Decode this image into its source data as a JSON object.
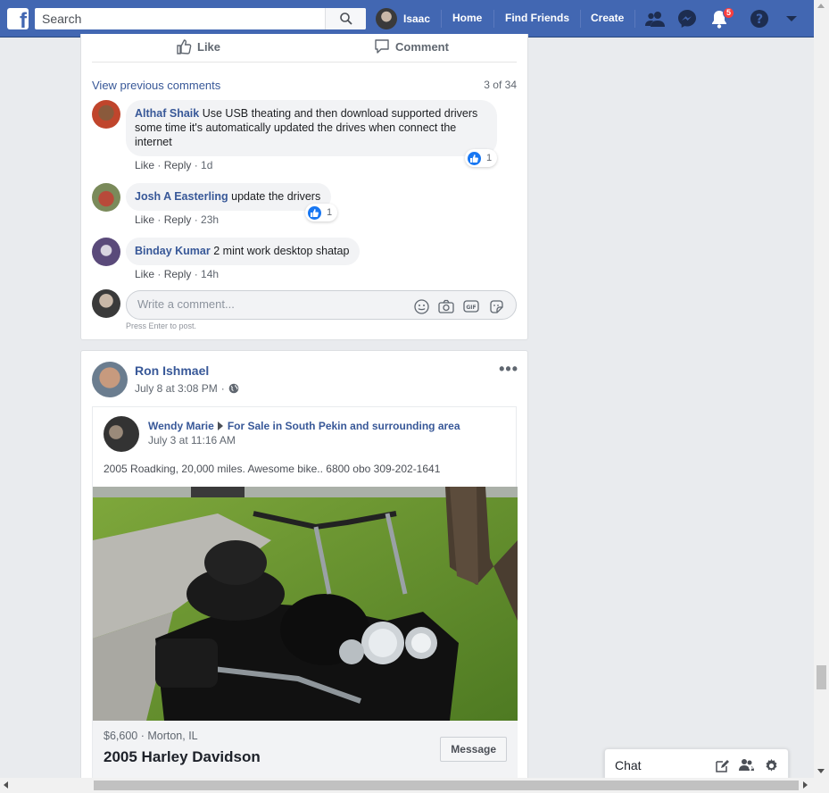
{
  "topbar": {
    "search_placeholder": "Search",
    "user_name": "Isaac",
    "home": "Home",
    "find_friends": "Find Friends",
    "create": "Create",
    "notification_count": "5"
  },
  "post1": {
    "like_label": "Like",
    "comment_label": "Comment",
    "view_previous": "View previous comments",
    "count": "3 of 34",
    "comments": [
      {
        "name": "Althaf Shaik",
        "text": "Use USB theating and then download supported drivers some time it's automatically updated the drives when connect the internet",
        "like": "Like",
        "reply": "Reply",
        "time": "1d",
        "reactions": "1"
      },
      {
        "name": "Josh A Easterling",
        "text": "update the drivers",
        "like": "Like",
        "reply": "Reply",
        "time": "23h",
        "reactions": "1"
      },
      {
        "name": "Binday Kumar",
        "text": "2 mint work desktop shatap",
        "like": "Like",
        "reply": "Reply",
        "time": "14h"
      }
    ],
    "write_placeholder": "Write a comment...",
    "press_enter": "Press Enter to post."
  },
  "post2": {
    "author": "Ron Ishmael",
    "time": "July 8 at 3:08 PM",
    "shared": {
      "author": "Wendy Marie",
      "group": "For Sale in South Pekin and surrounding area",
      "time": "July 3 at 11:16 AM",
      "text": "2005 Roadking, 20,000 miles. Awesome bike.. 6800 obo 309-202-1641",
      "price_location": "$6,600 · Morton, IL",
      "title": "2005 Harley Davidson",
      "message_button": "Message"
    }
  },
  "chat": {
    "label": "Chat"
  },
  "colors": {
    "brand": "#4267b2",
    "link": "#385898",
    "badge": "#fa3e3e"
  }
}
